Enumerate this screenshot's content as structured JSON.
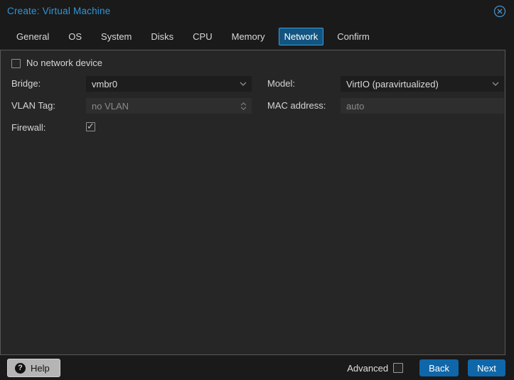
{
  "window": {
    "title": "Create: Virtual Machine"
  },
  "tabs": [
    {
      "label": "General",
      "active": false
    },
    {
      "label": "OS",
      "active": false
    },
    {
      "label": "System",
      "active": false
    },
    {
      "label": "Disks",
      "active": false
    },
    {
      "label": "CPU",
      "active": false
    },
    {
      "label": "Memory",
      "active": false
    },
    {
      "label": "Network",
      "active": true
    },
    {
      "label": "Confirm",
      "active": false
    }
  ],
  "form": {
    "no_network_device": {
      "label": "No network device",
      "checked": false
    },
    "bridge": {
      "label": "Bridge:",
      "value": "vmbr0"
    },
    "vlan_tag": {
      "label": "VLAN Tag:",
      "placeholder": "no VLAN"
    },
    "firewall": {
      "label": "Firewall:",
      "checked": true
    },
    "model": {
      "label": "Model:",
      "value": "VirtIO (paravirtualized)"
    },
    "mac_address": {
      "label": "MAC address:",
      "placeholder": "auto"
    }
  },
  "footer": {
    "help": "Help",
    "help_icon": "question-circle",
    "advanced": {
      "label": "Advanced",
      "checked": false
    },
    "back": "Back",
    "next": "Next"
  },
  "colors": {
    "title_accent": "#2e96d8",
    "active_tab_bg": "#135480",
    "active_tab_border": "#3d9cd6",
    "primary_button": "#0f67a9",
    "panel_bg": "#262626",
    "window_bg": "#1a1a1a"
  }
}
